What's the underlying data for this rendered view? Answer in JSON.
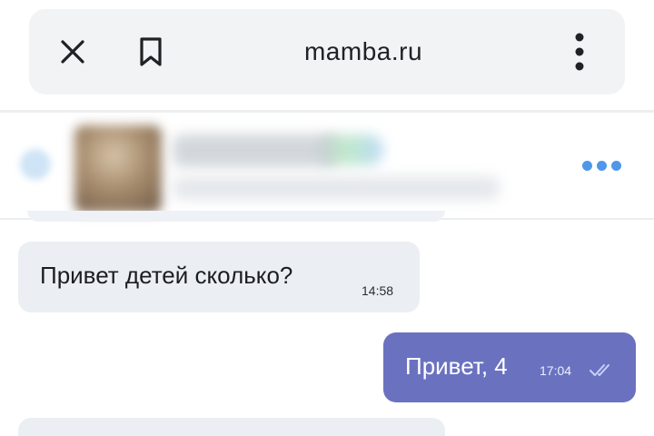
{
  "browser": {
    "url": "mamba.ru",
    "close_icon": "close-icon",
    "bookmark_icon": "bookmark-icon",
    "menu_icon": "more-vertical-icon"
  },
  "chat_header": {
    "back_icon": "back-arrow-icon",
    "options_icon": "more-horizontal-icon",
    "accent_color": "#4f97ea"
  },
  "messages": [
    {
      "direction": "incoming",
      "text": "Привет детей сколько?",
      "time": "14:58"
    },
    {
      "direction": "outgoing",
      "text": "Привет, 4",
      "time": "17:04",
      "status_icon": "double-check-icon"
    }
  ],
  "colors": {
    "incoming_bubble": "#ebeff4",
    "outgoing_bubble": "#6a72c0",
    "url_bar": "#f1f3f4"
  }
}
